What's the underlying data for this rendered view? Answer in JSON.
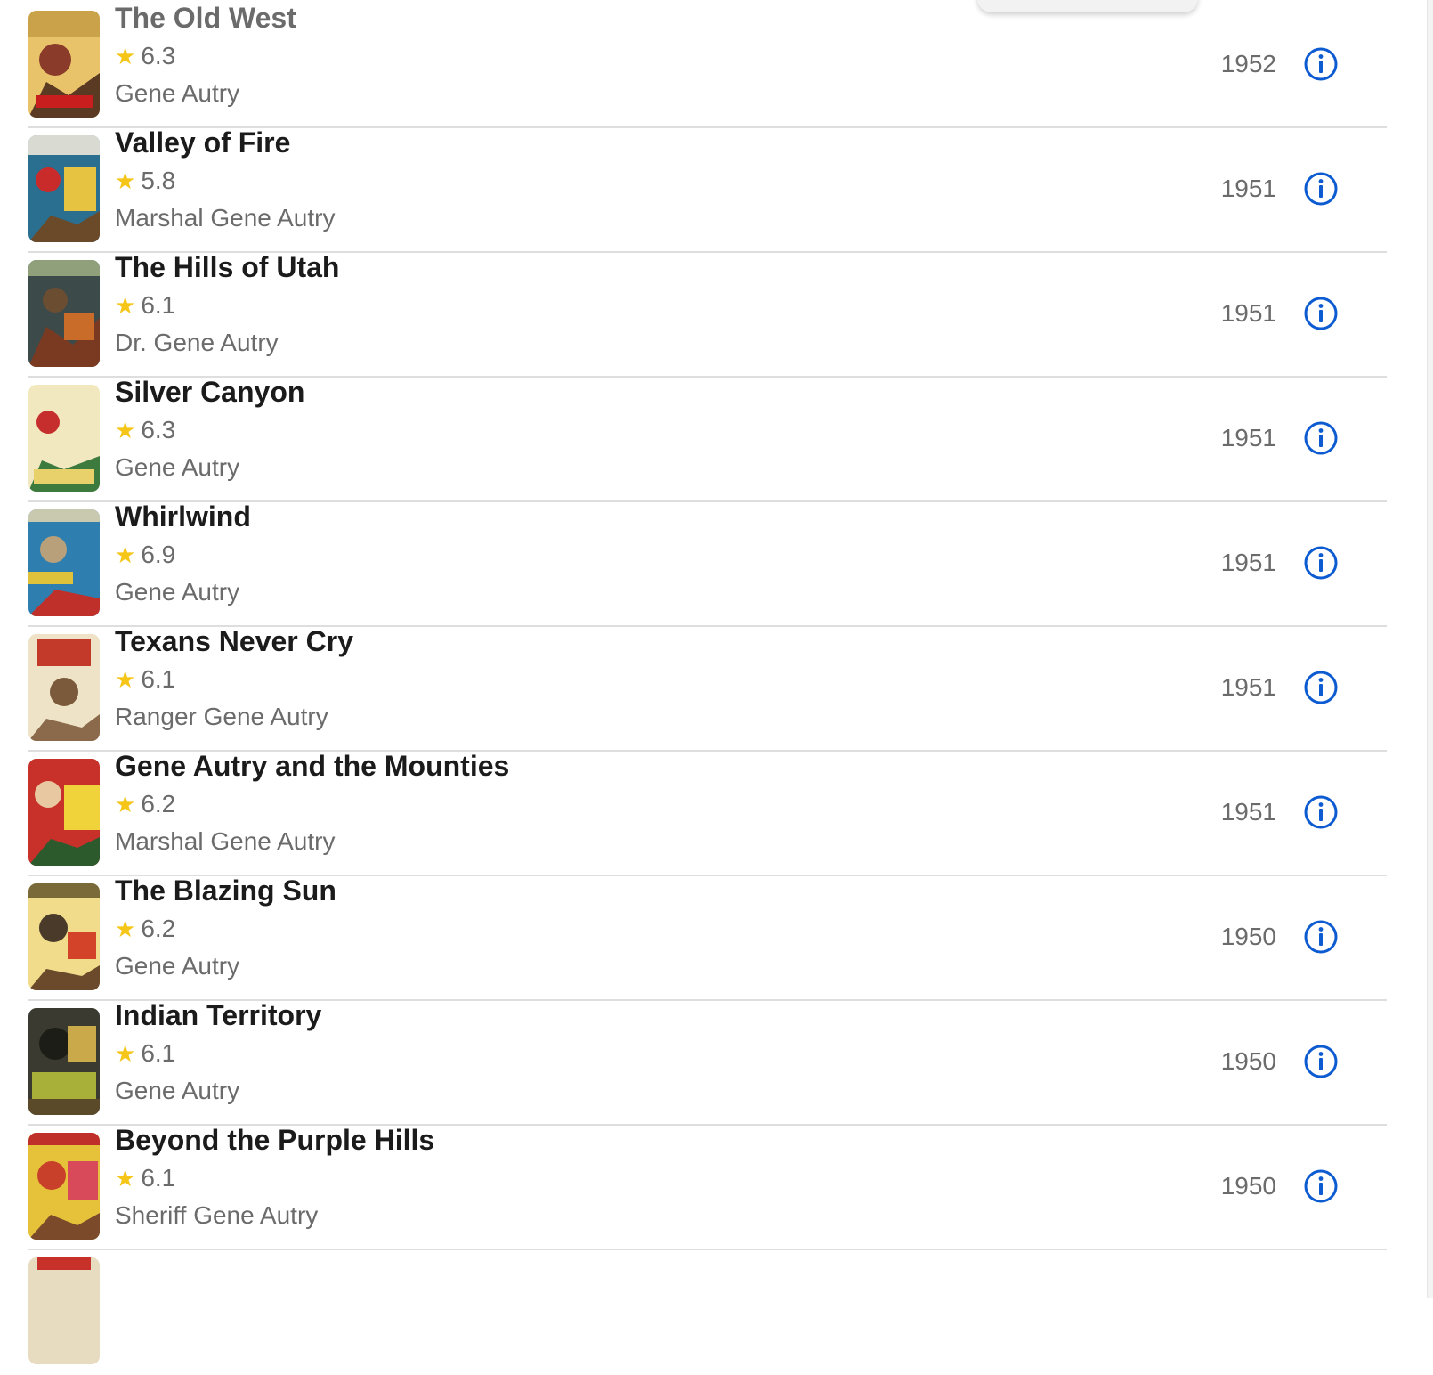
{
  "colors": {
    "accent": "#0d5bd1",
    "star": "#f5c518"
  },
  "movies": [
    {
      "title": "The Old West",
      "rating": "6.3",
      "role": "Gene Autry",
      "year": "1952"
    },
    {
      "title": "Valley of Fire",
      "rating": "5.8",
      "role": "Marshal Gene Autry",
      "year": "1951"
    },
    {
      "title": "The Hills of Utah",
      "rating": "6.1",
      "role": "Dr. Gene Autry",
      "year": "1951"
    },
    {
      "title": "Silver Canyon",
      "rating": "6.3",
      "role": "Gene Autry",
      "year": "1951"
    },
    {
      "title": "Whirlwind",
      "rating": "6.9",
      "role": "Gene Autry",
      "year": "1951"
    },
    {
      "title": "Texans Never Cry",
      "rating": "6.1",
      "role": "Ranger Gene Autry",
      "year": "1951"
    },
    {
      "title": "Gene Autry and the Mounties",
      "rating": "6.2",
      "role": "Marshal Gene Autry",
      "year": "1951"
    },
    {
      "title": "The Blazing Sun",
      "rating": "6.2",
      "role": "Gene Autry",
      "year": "1950"
    },
    {
      "title": "Indian Territory",
      "rating": "6.1",
      "role": "Gene Autry",
      "year": "1950"
    },
    {
      "title": "Beyond the Purple Hills",
      "rating": "6.1",
      "role": "Sheriff Gene Autry",
      "year": "1950"
    },
    {
      "title": "",
      "rating": "",
      "role": "",
      "year": ""
    }
  ]
}
